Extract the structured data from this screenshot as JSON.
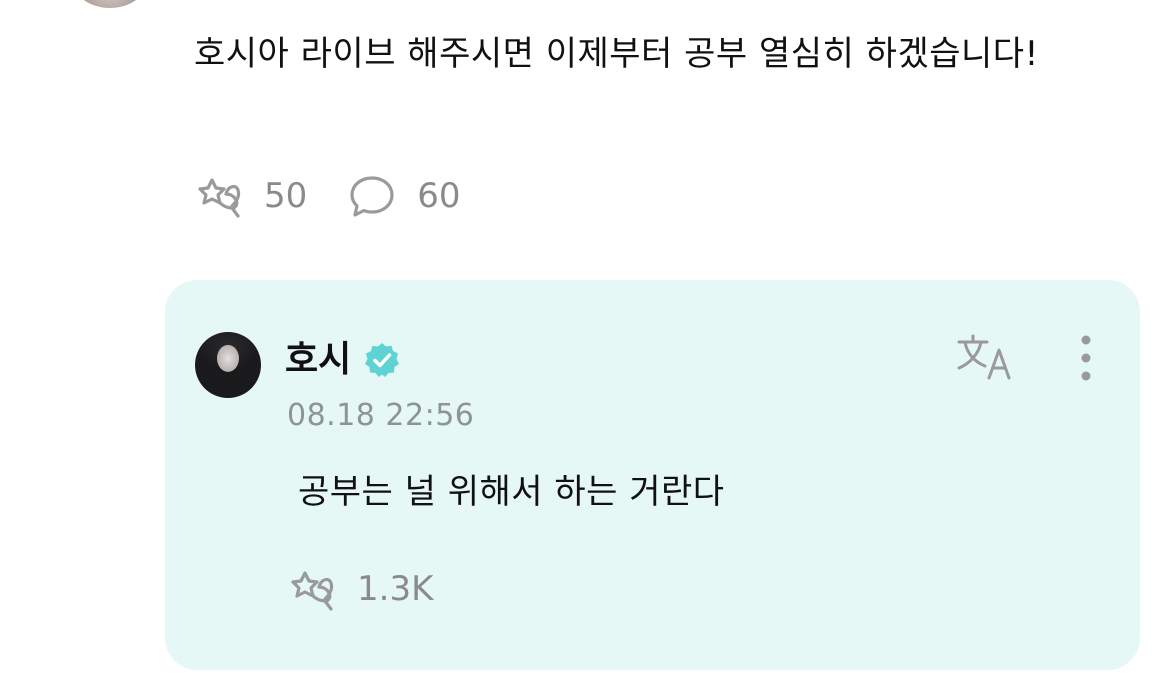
{
  "post": {
    "text": "호시아 라이브 해주시면 이제부터 공부 열심히 하겠습니다!",
    "reaction_count": "50",
    "comment_count": "60"
  },
  "reply": {
    "author": "호시",
    "time": "08.18 22:56",
    "text": "공부는 널 위해서 하는 거란다",
    "reaction_count": "1.3K"
  },
  "icons": {
    "reaction": "heart-cheer-icon",
    "comment": "speech-bubble-icon",
    "verified": "verified-badge-icon",
    "translate": "translate-icon",
    "more": "more-vertical-icon"
  },
  "colors": {
    "reply_background": "#e6f8f5",
    "verified_badge": "#5fd3d3",
    "muted_text": "#8a8a8a",
    "icon_gray": "#9a9a9a"
  }
}
